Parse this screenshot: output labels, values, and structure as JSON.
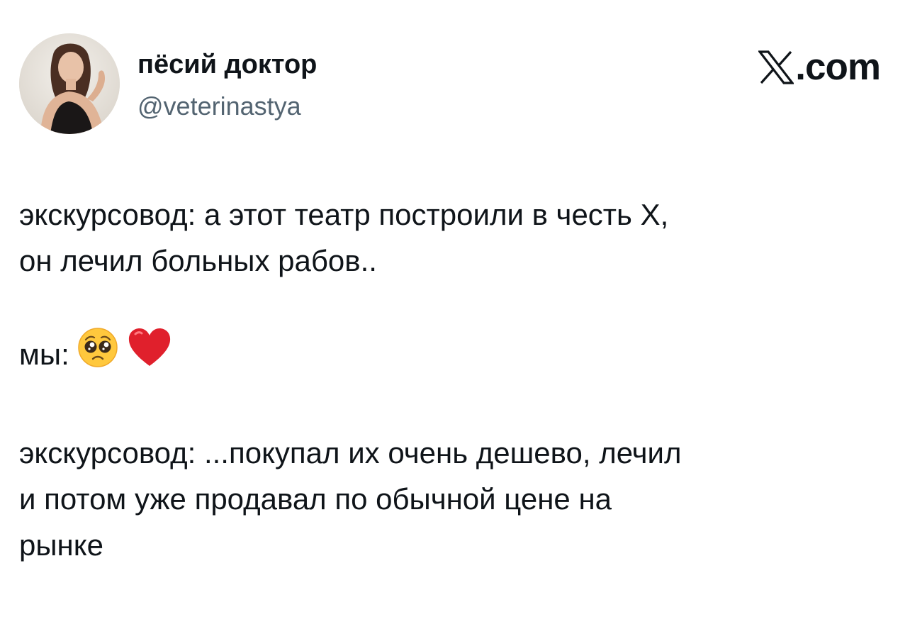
{
  "author": {
    "display_name": "пёсий доктор",
    "handle": "@veterinastya",
    "avatar": "avatar-photo"
  },
  "brand": {
    "logo_icon": "x-logo-icon",
    "suffix": ".com"
  },
  "tweet": {
    "paragraphs": [
      "экскурсовод: а этот театр построили в честь Х,\nон лечил больных рабов..",
      "мы:",
      "экскурсовод: ...покупал их очень дешево, лечил\nи потом уже продавал по обычной цене на\nрынке"
    ],
    "emojis": [
      "pleading-face-emoji",
      "red-heart-emoji"
    ]
  },
  "colors": {
    "text": "#0f1419",
    "secondary_text": "#536471",
    "background": "#ffffff",
    "heart": "#e0202c",
    "face": "#ffc83d"
  }
}
